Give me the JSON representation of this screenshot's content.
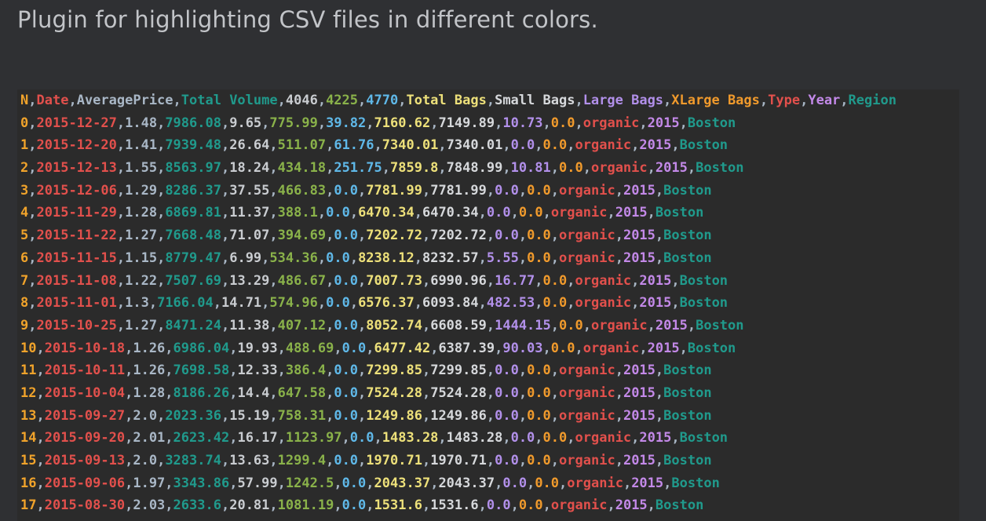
{
  "page": {
    "title": "Plugin for highlighting CSV files in different colors."
  },
  "palette": [
    "#f0a32b",
    "#e2504c",
    "#a9b7c6",
    "#209a8c",
    "#c9ccd0",
    "#8ab24a",
    "#5fb8e8",
    "#ede07a",
    "#d6d8db",
    "#b290ea",
    "#f09a2c",
    "#e2504c",
    "#c389e8",
    "#209a8c"
  ],
  "header": [
    "N",
    "Date",
    "AveragePrice",
    "Total Volume",
    "4046",
    "4225",
    "4770",
    "Total Bags",
    "Small Bags",
    "Large Bags",
    "XLarge Bags",
    "Type",
    "Year",
    "Region"
  ],
  "rows": [
    [
      "0",
      "2015-12-27",
      "1.48",
      "7986.08",
      "9.65",
      "775.99",
      "39.82",
      "7160.62",
      "7149.89",
      "10.73",
      "0.0",
      "organic",
      "2015",
      "Boston"
    ],
    [
      "1",
      "2015-12-20",
      "1.41",
      "7939.48",
      "26.64",
      "511.07",
      "61.76",
      "7340.01",
      "7340.01",
      "0.0",
      "0.0",
      "organic",
      "2015",
      "Boston"
    ],
    [
      "2",
      "2015-12-13",
      "1.55",
      "8563.97",
      "18.24",
      "434.18",
      "251.75",
      "7859.8",
      "7848.99",
      "10.81",
      "0.0",
      "organic",
      "2015",
      "Boston"
    ],
    [
      "3",
      "2015-12-06",
      "1.29",
      "8286.37",
      "37.55",
      "466.83",
      "0.0",
      "7781.99",
      "7781.99",
      "0.0",
      "0.0",
      "organic",
      "2015",
      "Boston"
    ],
    [
      "4",
      "2015-11-29",
      "1.28",
      "6869.81",
      "11.37",
      "388.1",
      "0.0",
      "6470.34",
      "6470.34",
      "0.0",
      "0.0",
      "organic",
      "2015",
      "Boston"
    ],
    [
      "5",
      "2015-11-22",
      "1.27",
      "7668.48",
      "71.07",
      "394.69",
      "0.0",
      "7202.72",
      "7202.72",
      "0.0",
      "0.0",
      "organic",
      "2015",
      "Boston"
    ],
    [
      "6",
      "2015-11-15",
      "1.15",
      "8779.47",
      "6.99",
      "534.36",
      "0.0",
      "8238.12",
      "8232.57",
      "5.55",
      "0.0",
      "organic",
      "2015",
      "Boston"
    ],
    [
      "7",
      "2015-11-08",
      "1.22",
      "7507.69",
      "13.29",
      "486.67",
      "0.0",
      "7007.73",
      "6990.96",
      "16.77",
      "0.0",
      "organic",
      "2015",
      "Boston"
    ],
    [
      "8",
      "2015-11-01",
      "1.3",
      "7166.04",
      "14.71",
      "574.96",
      "0.0",
      "6576.37",
      "6093.84",
      "482.53",
      "0.0",
      "organic",
      "2015",
      "Boston"
    ],
    [
      "9",
      "2015-10-25",
      "1.27",
      "8471.24",
      "11.38",
      "407.12",
      "0.0",
      "8052.74",
      "6608.59",
      "1444.15",
      "0.0",
      "organic",
      "2015",
      "Boston"
    ],
    [
      "10",
      "2015-10-18",
      "1.26",
      "6986.04",
      "19.93",
      "488.69",
      "0.0",
      "6477.42",
      "6387.39",
      "90.03",
      "0.0",
      "organic",
      "2015",
      "Boston"
    ],
    [
      "11",
      "2015-10-11",
      "1.26",
      "7698.58",
      "12.33",
      "386.4",
      "0.0",
      "7299.85",
      "7299.85",
      "0.0",
      "0.0",
      "organic",
      "2015",
      "Boston"
    ],
    [
      "12",
      "2015-10-04",
      "1.28",
      "8186.26",
      "14.4",
      "647.58",
      "0.0",
      "7524.28",
      "7524.28",
      "0.0",
      "0.0",
      "organic",
      "2015",
      "Boston"
    ],
    [
      "13",
      "2015-09-27",
      "2.0",
      "2023.36",
      "15.19",
      "758.31",
      "0.0",
      "1249.86",
      "1249.86",
      "0.0",
      "0.0",
      "organic",
      "2015",
      "Boston"
    ],
    [
      "14",
      "2015-09-20",
      "2.01",
      "2623.42",
      "16.17",
      "1123.97",
      "0.0",
      "1483.28",
      "1483.28",
      "0.0",
      "0.0",
      "organic",
      "2015",
      "Boston"
    ],
    [
      "15",
      "2015-09-13",
      "2.0",
      "3283.74",
      "13.63",
      "1299.4",
      "0.0",
      "1970.71",
      "1970.71",
      "0.0",
      "0.0",
      "organic",
      "2015",
      "Boston"
    ],
    [
      "16",
      "2015-09-06",
      "1.97",
      "3343.86",
      "57.99",
      "1242.5",
      "0.0",
      "2043.37",
      "2043.37",
      "0.0",
      "0.0",
      "organic",
      "2015",
      "Boston"
    ],
    [
      "17",
      "2015-08-30",
      "2.03",
      "2633.6",
      "20.81",
      "1081.19",
      "0.0",
      "1531.6",
      "1531.6",
      "0.0",
      "0.0",
      "organic",
      "2015",
      "Boston"
    ]
  ]
}
